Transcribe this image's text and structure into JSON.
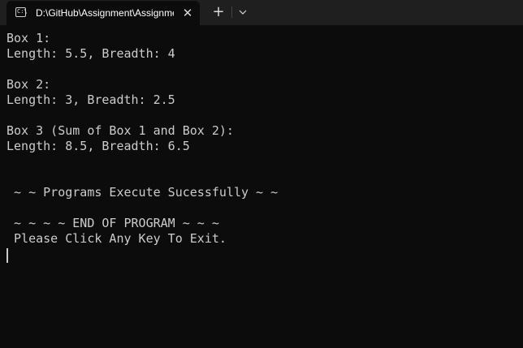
{
  "window": {
    "tab_title": "D:\\GitHub\\Assignment\\Assignment",
    "tab_icon": "terminal-icon",
    "tab_icon_glyph": "C:\\",
    "close_glyph": "✕",
    "new_tab_glyph": "+",
    "dropdown_icon": "chevron-down-icon"
  },
  "terminal": {
    "lines": [
      "Box 1:",
      "Length: 5.5, Breadth: 4",
      "",
      "Box 2:",
      "Length: 3, Breadth: 2.5",
      "",
      "Box 3 (Sum of Box 1 and Box 2):",
      "Length: 8.5, Breadth: 6.5",
      "",
      "",
      " ~ ~ Programs Execute Sucessfully ~ ~",
      "",
      " ~ ~ ~ ~ END OF PROGRAM ~ ~ ~",
      " Please Click Any Key To Exit."
    ]
  },
  "colors": {
    "background": "#0c0c0c",
    "titlebar": "#1f1f1f",
    "text": "#cccccc"
  }
}
